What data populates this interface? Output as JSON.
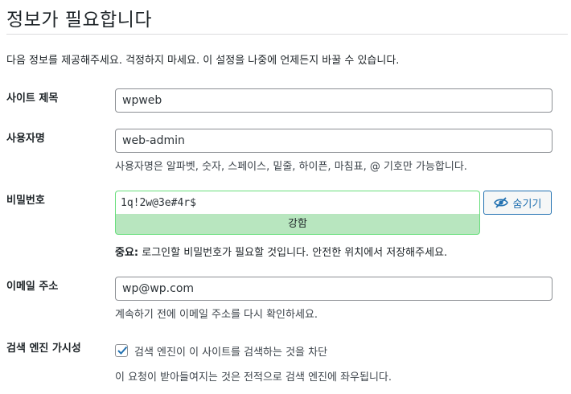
{
  "heading": "정보가 필요합니다",
  "intro": "다음 정보를 제공해주세요. 걱정하지 마세요. 이 설정을 나중에 언제든지 바꿀 수 있습니다.",
  "site_title": {
    "label": "사이트 제목",
    "value": "wpweb"
  },
  "username": {
    "label": "사용자명",
    "value": "web-admin",
    "description": "사용자명은 알파벳, 숫자, 스페이스, 밑줄, 하이픈, 마침표, @ 기호만 가능합니다."
  },
  "password": {
    "label": "비밀번호",
    "value": "1q!2w@3e#4r$",
    "strength": "강함",
    "hide_button": "숨기기",
    "note_strong": "중요:",
    "note": " 로그인할 비밀번호가 필요할 것입니다. 안전한 위치에서 저장해주세요."
  },
  "email": {
    "label": "이메일 주소",
    "value": "wp@wp.com",
    "description": "계속하기 전에 이메일 주소를 다시 확인하세요."
  },
  "search_visibility": {
    "label": "검색 엔진 가시성",
    "checked": true,
    "checkbox_label": "검색 엔진이 이 사이트를 검색하는 것을 차단",
    "description": "이 요청이 받아들여지는 것은 전적으로 검색 엔진에 좌우됩니다."
  },
  "colors": {
    "accent": "#2271b1",
    "strength_bg": "#b8e6bf",
    "strength_border": "#68de7c"
  },
  "icons": {
    "hide": "eye-slash-icon",
    "check": "checkmark-icon"
  }
}
